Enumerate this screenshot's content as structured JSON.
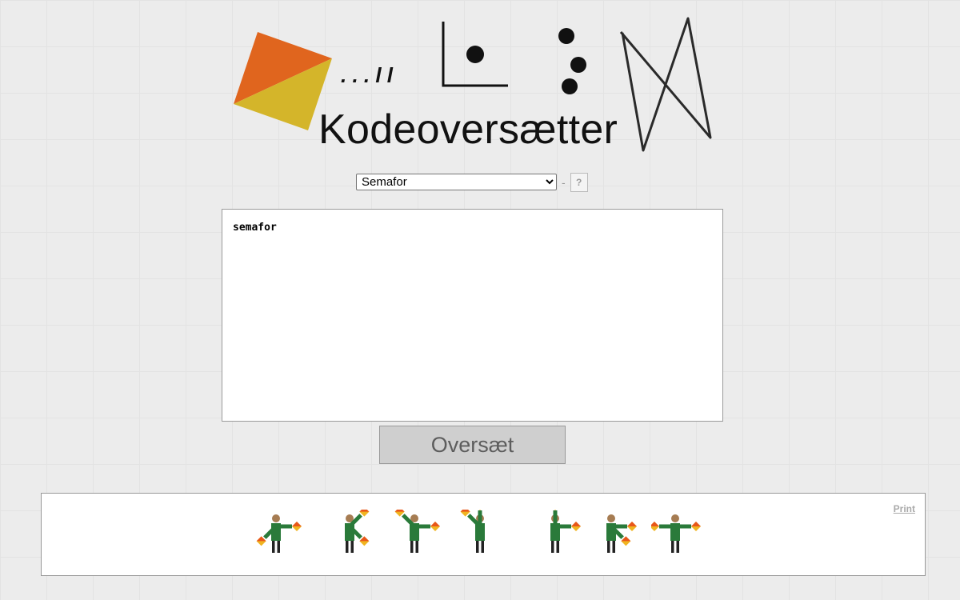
{
  "header": {
    "title": "Kodeoversætter",
    "logo_text": ". . . l l"
  },
  "selector": {
    "selected": "Semafor",
    "options": [
      "Semafor"
    ],
    "separator": "-",
    "help_label": "?"
  },
  "input": {
    "value": "semafor"
  },
  "translate_button": {
    "label": "Oversæt"
  },
  "output": {
    "print_label": "Print",
    "letters": [
      "s",
      "e",
      "m",
      "a",
      "f",
      "o",
      "r"
    ]
  },
  "colors": {
    "flag_red": "#e8561a",
    "flag_yellow": "#f0b420",
    "shirt": "#2a7a3a",
    "skin": "#a67c52",
    "legs": "#222222",
    "logo_orange": "#e0651e",
    "logo_yellow": "#d4b52a"
  }
}
